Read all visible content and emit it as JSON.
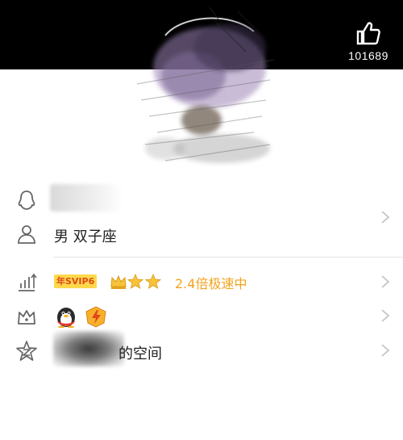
{
  "header": {
    "like_count": "101689"
  },
  "profile": {
    "gender_zodiac": "男 双子座"
  },
  "vip": {
    "tag": "年SVIP6",
    "speed_text": "2.4倍极速中"
  },
  "space": {
    "label_suffix": "的空间"
  },
  "colors": {
    "topbar": "#000000",
    "accent_orange": "#f3a31d",
    "vip_yellow": "#ffd84a",
    "vip_text": "#d84b1a",
    "icon_gray": "#666666",
    "chevron_gray": "#c4c4c4"
  },
  "icons": {
    "like": "thumbs-up-icon",
    "penguin": "qq-penguin-icon",
    "person": "person-icon",
    "level": "level-bars-icon",
    "crown": "crown-icon",
    "space": "qzone-star-icon"
  }
}
